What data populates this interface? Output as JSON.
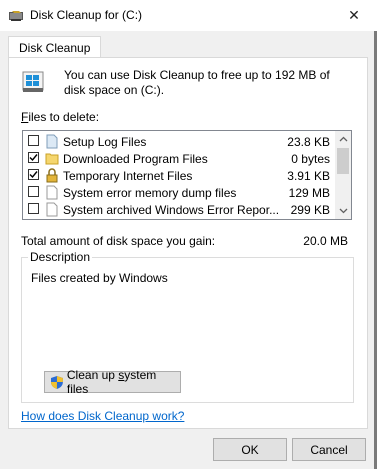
{
  "window": {
    "title": "Disk Cleanup for  (C:)",
    "close_glyph": "✕"
  },
  "tabs": [
    {
      "label": "Disk Cleanup",
      "active": true
    }
  ],
  "intro": {
    "text": "You can use Disk Cleanup to free up to 192 MB of disk space on  (C:).",
    "icon": "drive-cleanup-icon"
  },
  "files": {
    "label_underlined": "F",
    "label_rest": "iles to delete:",
    "items": [
      {
        "name": "Setup Log Files",
        "size": "23.8 KB",
        "checked": false,
        "icon": "file-icon"
      },
      {
        "name": "Downloaded Program Files",
        "size": "0 bytes",
        "checked": true,
        "icon": "folder-icon"
      },
      {
        "name": "Temporary Internet Files",
        "size": "3.91 KB",
        "checked": true,
        "icon": "lock-icon"
      },
      {
        "name": "System error memory dump files",
        "size": "129 MB",
        "checked": false,
        "icon": "file-icon"
      },
      {
        "name": "System archived Windows Error Repor...",
        "size": "299 KB",
        "checked": false,
        "icon": "file-icon"
      }
    ]
  },
  "total": {
    "label": "Total amount of disk space you gain:",
    "value": "20.0 MB"
  },
  "description": {
    "legend": "Description",
    "text": "Files created by Windows"
  },
  "cleanup_button": {
    "before": "Clean up ",
    "underlined": "s",
    "after": "ystem files"
  },
  "help_link": "How does Disk Cleanup work?",
  "buttons": {
    "ok": "OK",
    "cancel": "Cancel"
  },
  "colors": {
    "link": "#0066cc",
    "drive_accent": "#1e90d8"
  }
}
